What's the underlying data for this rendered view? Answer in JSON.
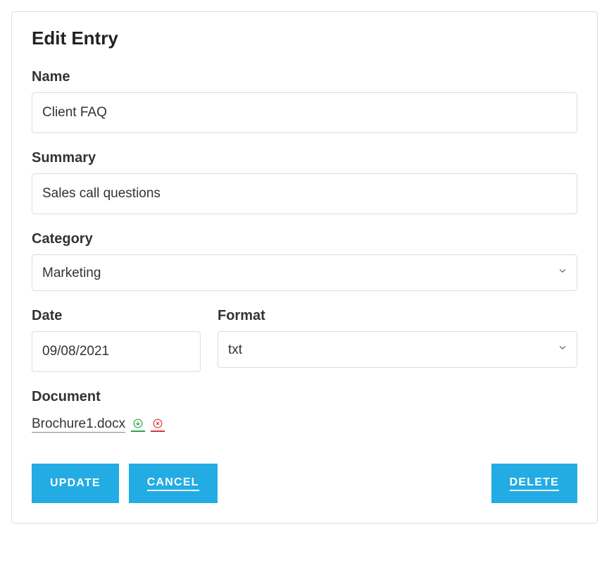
{
  "title": "Edit Entry",
  "fields": {
    "name": {
      "label": "Name",
      "value": "Client FAQ"
    },
    "summary": {
      "label": "Summary",
      "value": "Sales call questions"
    },
    "category": {
      "label": "Category",
      "value": "Marketing"
    },
    "date": {
      "label": "Date",
      "value": "09/08/2021"
    },
    "format": {
      "label": "Format",
      "value": "txt"
    },
    "document": {
      "label": "Document",
      "filename": "Brochure1.docx"
    }
  },
  "actions": {
    "update": "Update",
    "cancel": "Cancel",
    "delete": "Delete"
  }
}
